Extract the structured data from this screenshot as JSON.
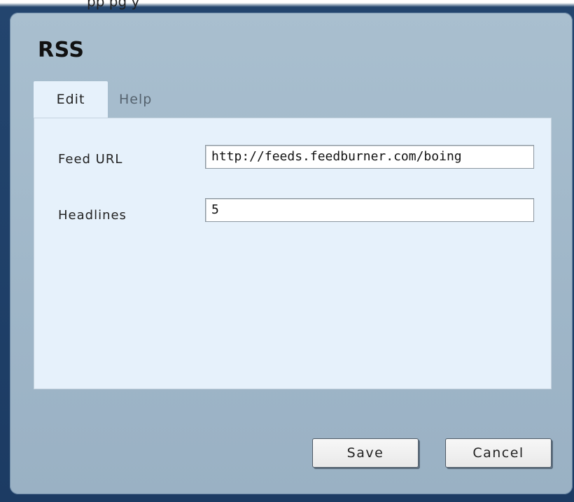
{
  "header": {
    "partial_text": "pp  pg  y"
  },
  "dialog": {
    "title": "RSS",
    "tabs": [
      {
        "label": "Edit",
        "active": true
      },
      {
        "label": "Help",
        "active": false
      }
    ],
    "fields": {
      "feed_url": {
        "label": "Feed URL",
        "value": "http://feeds.feedburner.com/boing"
      },
      "headlines": {
        "label": "Headlines",
        "value": "5"
      }
    },
    "buttons": {
      "save": "Save",
      "cancel": "Cancel"
    }
  },
  "colors": {
    "desktop_bg": "#1c3b63",
    "dialog_bg": "#a9bfcf",
    "panel_bg": "#e6f1fb",
    "inactive_tab_text": "#55626e"
  }
}
